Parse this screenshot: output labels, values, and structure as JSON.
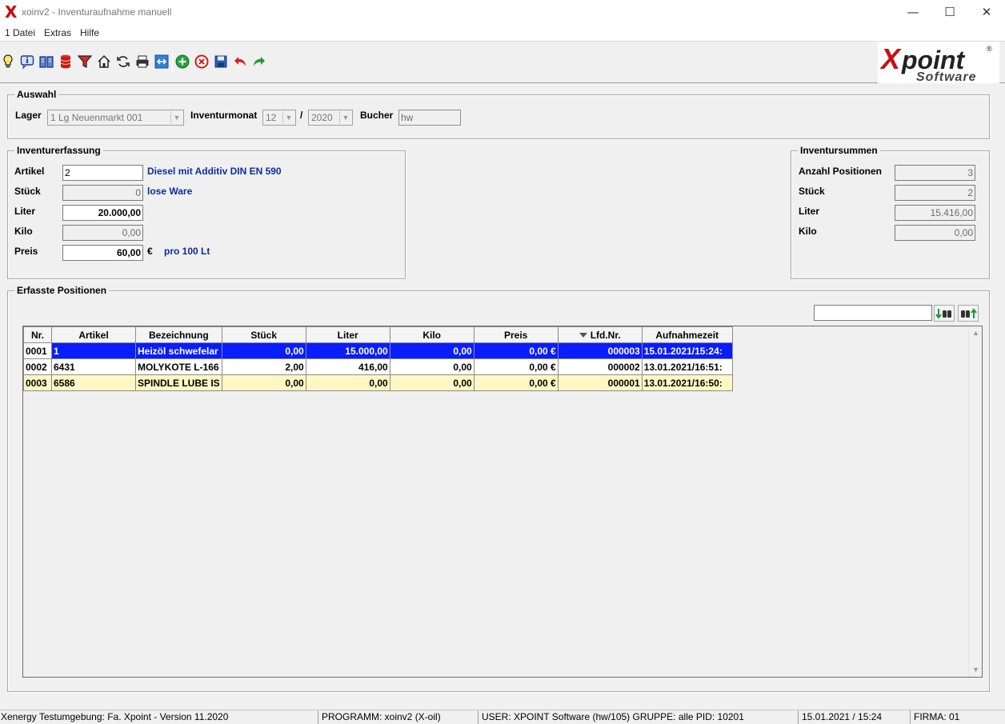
{
  "window": {
    "app_icon": "X",
    "title": "xoinv2 - Inventuraufnahme manuell",
    "controls": {
      "minimize": "—",
      "maximize": "☐",
      "close": "✕"
    }
  },
  "menu": [
    "1 Datei",
    "Extras",
    "Hilfe"
  ],
  "toolbar_icons": [
    "lightbulb-icon",
    "info-icon",
    "book-icon",
    "database-icon",
    "filter-icon",
    "home-icon",
    "refresh-icon",
    "print-icon",
    "export-icon",
    "add-icon",
    "delete-icon",
    "save-icon",
    "undo-icon",
    "redo-icon"
  ],
  "logo": {
    "main": "Xpoint",
    "sub": "Software",
    "reg": "®"
  },
  "auswahl": {
    "title": "Auswahl",
    "lager_label": "Lager",
    "lager_value": "1  Lg Neuenmarkt  001",
    "monat_label": "Inventurmonat",
    "monat_value": "12",
    "separator": "/",
    "jahr_value": "2020",
    "bucher_label": "Bucher",
    "bucher_value": "hw"
  },
  "erfassung": {
    "title": "Inventurerfassung",
    "artikel_label": "Artikel",
    "artikel_value": "2",
    "artikel_desc": "Diesel mit Additiv DIN EN 590",
    "stueck_label": "Stück",
    "stueck_value": "0",
    "stueck_desc": "lose Ware",
    "liter_label": "Liter",
    "liter_value": "20.000,00",
    "kilo_label": "Kilo",
    "kilo_value": "0,00",
    "preis_label": "Preis",
    "preis_value": "60,00",
    "currency": "€",
    "preis_desc": "pro 100 Lt"
  },
  "summen": {
    "title": "Inventursummen",
    "anzahl_label": "Anzahl Positionen",
    "anzahl_value": "3",
    "stueck_label": "Stück",
    "stueck_value": "2",
    "liter_label": "Liter",
    "liter_value": "15.416,00",
    "kilo_label": "Kilo",
    "kilo_value": "0,00"
  },
  "positionen": {
    "title": "Erfasste Positionen",
    "search_value": "",
    "columns": [
      "Nr.",
      "Artikel",
      "Bezeichnung",
      "Stück",
      "Liter",
      "Kilo",
      "Preis",
      "Lfd.Nr.",
      "Aufnahmezeit"
    ],
    "rows": [
      [
        "0001",
        "1",
        "Heizöl schwefelar",
        "0,00",
        "15.000,00",
        "0,00",
        "0,00 €",
        "000003",
        "15.01.2021/15:24:"
      ],
      [
        "0002",
        "6431",
        "MOLYKOTE L-166",
        "2,00",
        "416,00",
        "0,00",
        "0,00 €",
        "000002",
        "13.01.2021/16:51:"
      ],
      [
        "0003",
        "6586",
        "SPINDLE LUBE IS",
        "0,00",
        "0,00",
        "0,00",
        "0,00 €",
        "000001",
        "13.01.2021/16:50:"
      ]
    ]
  },
  "status": {
    "env": "Xenergy Testumgebung: Fa. Xpoint - Version 11.2020",
    "programm": "PROGRAMM: xoinv2 (X-oil)",
    "user": "USER: XPOINT Software (hw/105)  GRUPPE: alle  PID: 10201",
    "datetime": "15.01.2021 / 15:24",
    "firma": "FIRMA: 01"
  }
}
